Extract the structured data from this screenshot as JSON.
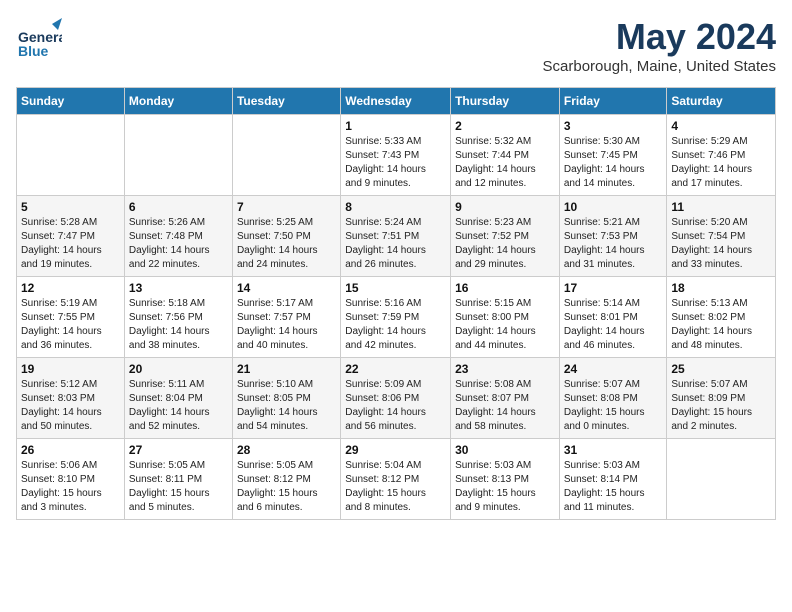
{
  "logo": {
    "line1": "General",
    "line2": "Blue"
  },
  "title": "May 2024",
  "location": "Scarborough, Maine, United States",
  "days_header": [
    "Sunday",
    "Monday",
    "Tuesday",
    "Wednesday",
    "Thursday",
    "Friday",
    "Saturday"
  ],
  "weeks": [
    [
      {
        "day": "",
        "info": ""
      },
      {
        "day": "",
        "info": ""
      },
      {
        "day": "",
        "info": ""
      },
      {
        "day": "1",
        "info": "Sunrise: 5:33 AM\nSunset: 7:43 PM\nDaylight: 14 hours\nand 9 minutes."
      },
      {
        "day": "2",
        "info": "Sunrise: 5:32 AM\nSunset: 7:44 PM\nDaylight: 14 hours\nand 12 minutes."
      },
      {
        "day": "3",
        "info": "Sunrise: 5:30 AM\nSunset: 7:45 PM\nDaylight: 14 hours\nand 14 minutes."
      },
      {
        "day": "4",
        "info": "Sunrise: 5:29 AM\nSunset: 7:46 PM\nDaylight: 14 hours\nand 17 minutes."
      }
    ],
    [
      {
        "day": "5",
        "info": "Sunrise: 5:28 AM\nSunset: 7:47 PM\nDaylight: 14 hours\nand 19 minutes."
      },
      {
        "day": "6",
        "info": "Sunrise: 5:26 AM\nSunset: 7:48 PM\nDaylight: 14 hours\nand 22 minutes."
      },
      {
        "day": "7",
        "info": "Sunrise: 5:25 AM\nSunset: 7:50 PM\nDaylight: 14 hours\nand 24 minutes."
      },
      {
        "day": "8",
        "info": "Sunrise: 5:24 AM\nSunset: 7:51 PM\nDaylight: 14 hours\nand 26 minutes."
      },
      {
        "day": "9",
        "info": "Sunrise: 5:23 AM\nSunset: 7:52 PM\nDaylight: 14 hours\nand 29 minutes."
      },
      {
        "day": "10",
        "info": "Sunrise: 5:21 AM\nSunset: 7:53 PM\nDaylight: 14 hours\nand 31 minutes."
      },
      {
        "day": "11",
        "info": "Sunrise: 5:20 AM\nSunset: 7:54 PM\nDaylight: 14 hours\nand 33 minutes."
      }
    ],
    [
      {
        "day": "12",
        "info": "Sunrise: 5:19 AM\nSunset: 7:55 PM\nDaylight: 14 hours\nand 36 minutes."
      },
      {
        "day": "13",
        "info": "Sunrise: 5:18 AM\nSunset: 7:56 PM\nDaylight: 14 hours\nand 38 minutes."
      },
      {
        "day": "14",
        "info": "Sunrise: 5:17 AM\nSunset: 7:57 PM\nDaylight: 14 hours\nand 40 minutes."
      },
      {
        "day": "15",
        "info": "Sunrise: 5:16 AM\nSunset: 7:59 PM\nDaylight: 14 hours\nand 42 minutes."
      },
      {
        "day": "16",
        "info": "Sunrise: 5:15 AM\nSunset: 8:00 PM\nDaylight: 14 hours\nand 44 minutes."
      },
      {
        "day": "17",
        "info": "Sunrise: 5:14 AM\nSunset: 8:01 PM\nDaylight: 14 hours\nand 46 minutes."
      },
      {
        "day": "18",
        "info": "Sunrise: 5:13 AM\nSunset: 8:02 PM\nDaylight: 14 hours\nand 48 minutes."
      }
    ],
    [
      {
        "day": "19",
        "info": "Sunrise: 5:12 AM\nSunset: 8:03 PM\nDaylight: 14 hours\nand 50 minutes."
      },
      {
        "day": "20",
        "info": "Sunrise: 5:11 AM\nSunset: 8:04 PM\nDaylight: 14 hours\nand 52 minutes."
      },
      {
        "day": "21",
        "info": "Sunrise: 5:10 AM\nSunset: 8:05 PM\nDaylight: 14 hours\nand 54 minutes."
      },
      {
        "day": "22",
        "info": "Sunrise: 5:09 AM\nSunset: 8:06 PM\nDaylight: 14 hours\nand 56 minutes."
      },
      {
        "day": "23",
        "info": "Sunrise: 5:08 AM\nSunset: 8:07 PM\nDaylight: 14 hours\nand 58 minutes."
      },
      {
        "day": "24",
        "info": "Sunrise: 5:07 AM\nSunset: 8:08 PM\nDaylight: 15 hours\nand 0 minutes."
      },
      {
        "day": "25",
        "info": "Sunrise: 5:07 AM\nSunset: 8:09 PM\nDaylight: 15 hours\nand 2 minutes."
      }
    ],
    [
      {
        "day": "26",
        "info": "Sunrise: 5:06 AM\nSunset: 8:10 PM\nDaylight: 15 hours\nand 3 minutes."
      },
      {
        "day": "27",
        "info": "Sunrise: 5:05 AM\nSunset: 8:11 PM\nDaylight: 15 hours\nand 5 minutes."
      },
      {
        "day": "28",
        "info": "Sunrise: 5:05 AM\nSunset: 8:12 PM\nDaylight: 15 hours\nand 6 minutes."
      },
      {
        "day": "29",
        "info": "Sunrise: 5:04 AM\nSunset: 8:12 PM\nDaylight: 15 hours\nand 8 minutes."
      },
      {
        "day": "30",
        "info": "Sunrise: 5:03 AM\nSunset: 8:13 PM\nDaylight: 15 hours\nand 9 minutes."
      },
      {
        "day": "31",
        "info": "Sunrise: 5:03 AM\nSunset: 8:14 PM\nDaylight: 15 hours\nand 11 minutes."
      },
      {
        "day": "",
        "info": ""
      }
    ]
  ]
}
